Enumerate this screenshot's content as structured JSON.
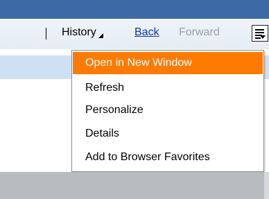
{
  "toolbar": {
    "separator": "|",
    "history_label": "History",
    "back_label": "Back",
    "forward_label": "Forward"
  },
  "menu": {
    "items": [
      {
        "label": "Open in New Window",
        "selected": true
      },
      {
        "label": "Refresh"
      },
      {
        "label": "Personalize"
      },
      {
        "label": "Details"
      },
      {
        "label": "Add to Browser Favorites"
      }
    ]
  },
  "colors": {
    "topbar": "#3b6aa6",
    "selected_item": "#ff7a00",
    "link": "#0d35a8",
    "disabled": "#9aa0a6",
    "light_band": "#cfe0f3",
    "gray_band": "#b9bcbf"
  },
  "icons": {
    "history_dropdown": "triangle-down-icon",
    "menu_button": "menu-lines-icon"
  }
}
